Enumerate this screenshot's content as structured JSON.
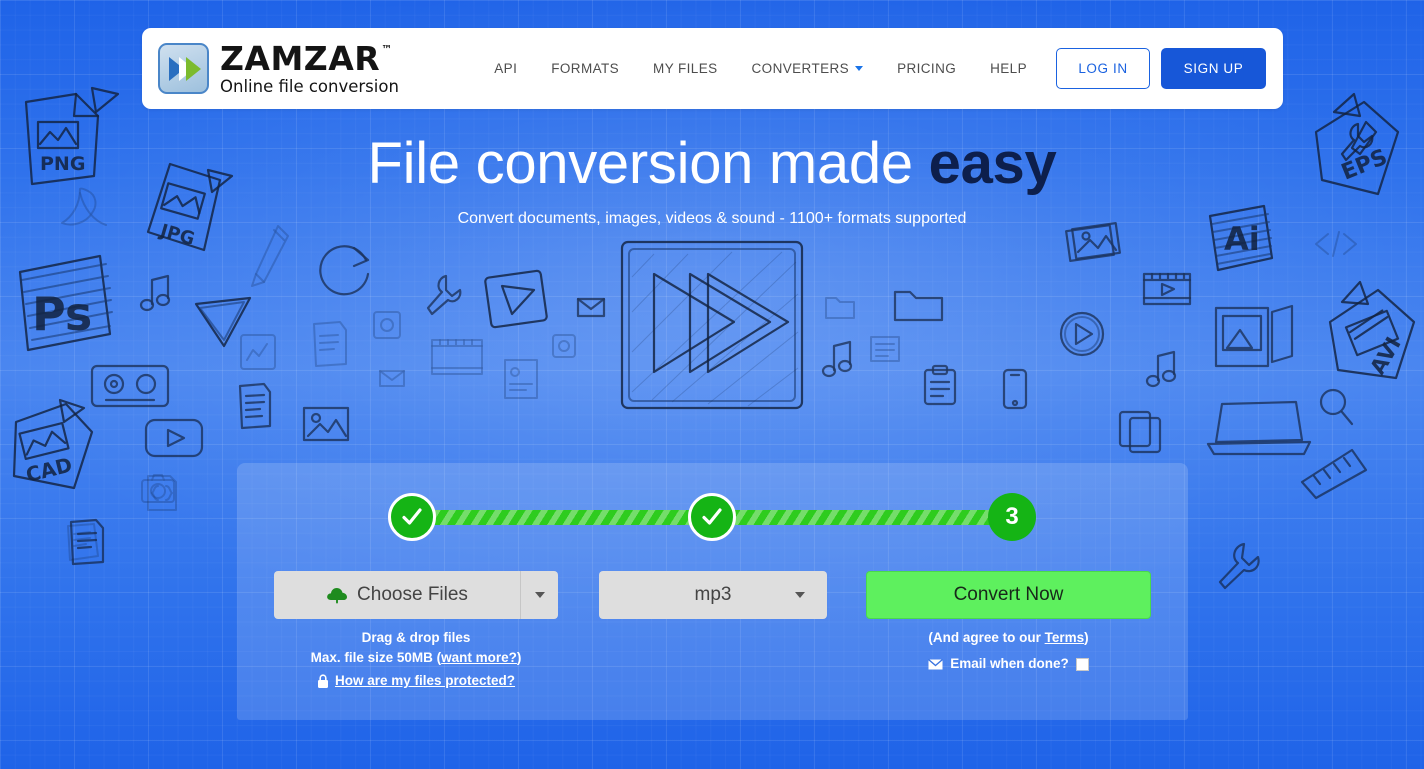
{
  "header": {
    "brand": {
      "name": "ZAMZAR",
      "tm": "™",
      "tagline": "Online file conversion",
      "logo_icon": "zamzar-chevrons-icon"
    },
    "nav": [
      {
        "label": "API",
        "name": "nav-api"
      },
      {
        "label": "FORMATS",
        "name": "nav-formats"
      },
      {
        "label": "MY FILES",
        "name": "nav-my-files"
      },
      {
        "label": "CONVERTERS",
        "name": "nav-converters",
        "has_caret": true
      },
      {
        "label": "PRICING",
        "name": "nav-pricing"
      },
      {
        "label": "HELP",
        "name": "nav-help"
      }
    ],
    "login_label": "LOG IN",
    "signup_label": "SIGN UP"
  },
  "hero": {
    "title_plain": "File conversion made ",
    "title_bold": "easy",
    "subtitle": "Convert documents, images, videos & sound - 1100+ formats supported"
  },
  "steps": {
    "step1": {
      "state": "done",
      "icon": "check-icon"
    },
    "step2": {
      "state": "done",
      "icon": "check-icon"
    },
    "step3": {
      "state": "current",
      "label": "3"
    }
  },
  "converter": {
    "choose_files_label": "Choose Files",
    "choose_files_icon": "cloud-upload-icon",
    "choose_caret_icon": "caret-down-icon",
    "format_value": "mp3",
    "format_caret_icon": "caret-down-icon",
    "convert_label": "Convert Now",
    "drag_drop_text": "Drag & drop files",
    "max_size_prefix": "Max. file size 50MB (",
    "max_size_link": "want more?",
    "max_size_suffix": ")",
    "protected_link": "How are my files protected?",
    "protected_icon": "lock-icon",
    "terms_prefix": "(And agree to our ",
    "terms_link": "Terms",
    "terms_suffix": ")",
    "email_when_done_label": "Email when done?",
    "email_icon": "envelope-icon",
    "email_checked": false
  },
  "background": {
    "doodle_labels": [
      "PNG",
      "JPG",
      "Ps",
      "CAD",
      "EPS",
      "Ai",
      "AVI"
    ],
    "center_art": "fast-forward-sketch-icon"
  },
  "colors": {
    "page_blue": "#2f72ec",
    "brand_blue": "#1757d8",
    "accent_green": "#15b415",
    "convert_green": "#5ef05e",
    "heading_navy": "#0d1f4c",
    "control_grey": "#dedede"
  }
}
